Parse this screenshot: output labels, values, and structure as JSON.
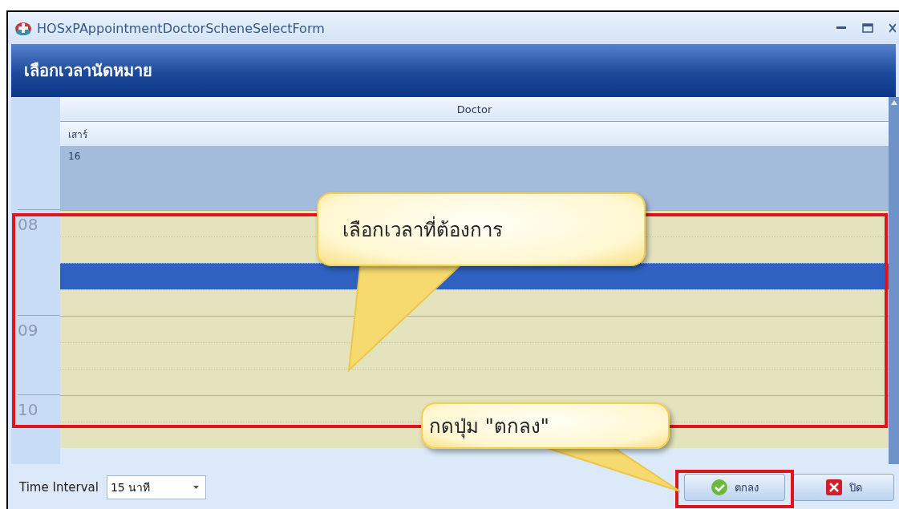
{
  "window": {
    "title": "HOSxPAppointmentDoctorScheneSelectForm"
  },
  "header": {
    "title": "เลือกเวลานัดหมาย"
  },
  "scheduler": {
    "resource": "Doctor",
    "day": "เสาร์",
    "date": "16",
    "hours": [
      {
        "label": "08",
        "slots": [
          {
            "selected": false
          },
          {
            "selected": false
          },
          {
            "selected": true
          },
          {
            "selected": false
          }
        ]
      },
      {
        "label": "09",
        "slots": [
          {
            "selected": false
          },
          {
            "selected": false
          },
          {
            "selected": false
          }
        ]
      },
      {
        "label": "10",
        "slots": [
          {
            "selected": false
          },
          {
            "selected": false
          }
        ]
      }
    ]
  },
  "footer": {
    "interval_label": "Time Interval",
    "interval_value": "15 นาที",
    "buttons": [
      {
        "kind": "ok",
        "label": "ตกลง"
      },
      {
        "kind": "close",
        "label": "ปิด"
      }
    ]
  },
  "annotations": [
    {
      "text": "เลือกเวลาที่ต้องการ"
    },
    {
      "text": "กดปุ่ม \"ตกลง\""
    }
  ]
}
